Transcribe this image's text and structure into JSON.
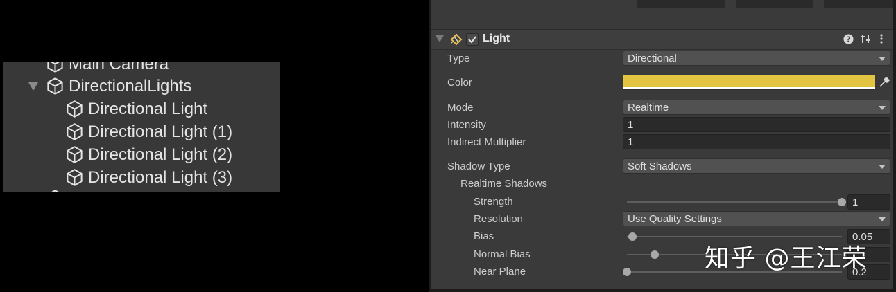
{
  "hierarchy": {
    "items": [
      {
        "label": "Main Camera",
        "icon": "cube-icon",
        "depth": 1
      },
      {
        "label": "DirectionalLights",
        "icon": "cube-icon",
        "depth": 1,
        "expanded": true
      },
      {
        "label": "Directional Light",
        "icon": "cube-icon",
        "depth": 2
      },
      {
        "label": "Directional Light (1)",
        "icon": "cube-icon",
        "depth": 2
      },
      {
        "label": "Directional Light (2)",
        "icon": "cube-icon",
        "depth": 2
      },
      {
        "label": "Directional Light (3)",
        "icon": "cube-icon",
        "depth": 2
      }
    ]
  },
  "inspector": {
    "component_title": "Light",
    "component_enabled": true,
    "header_icons": [
      "help-icon",
      "preset-icon",
      "kebab-menu-icon"
    ],
    "type": {
      "label": "Type",
      "value": "Directional"
    },
    "color": {
      "label": "Color",
      "value": "#e2c440"
    },
    "mode": {
      "label": "Mode",
      "value": "Realtime"
    },
    "intensity": {
      "label": "Intensity",
      "value": "1"
    },
    "indirect_multiplier": {
      "label": "Indirect Multiplier",
      "value": "1"
    },
    "shadow_type": {
      "label": "Shadow Type",
      "value": "Soft Shadows"
    },
    "realtime_shadows_label": "Realtime Shadows",
    "strength": {
      "label": "Strength",
      "value": "1",
      "fraction": 1.0
    },
    "resolution": {
      "label": "Resolution",
      "value": "Use Quality Settings"
    },
    "bias": {
      "label": "Bias",
      "value": "0.05",
      "fraction": 0.025
    },
    "normal_bias": {
      "label": "Normal Bias",
      "value": "",
      "fraction": 0.13
    },
    "near_plane": {
      "label": "Near Plane",
      "value": "0.2",
      "fraction": 0.0
    }
  },
  "watermark": "知乎 @王江荣",
  "colors": {
    "accent_yellow": "#e2c440",
    "panel": "#3a3a3a",
    "field": "#2a2a2a",
    "dropdown": "#515151"
  }
}
